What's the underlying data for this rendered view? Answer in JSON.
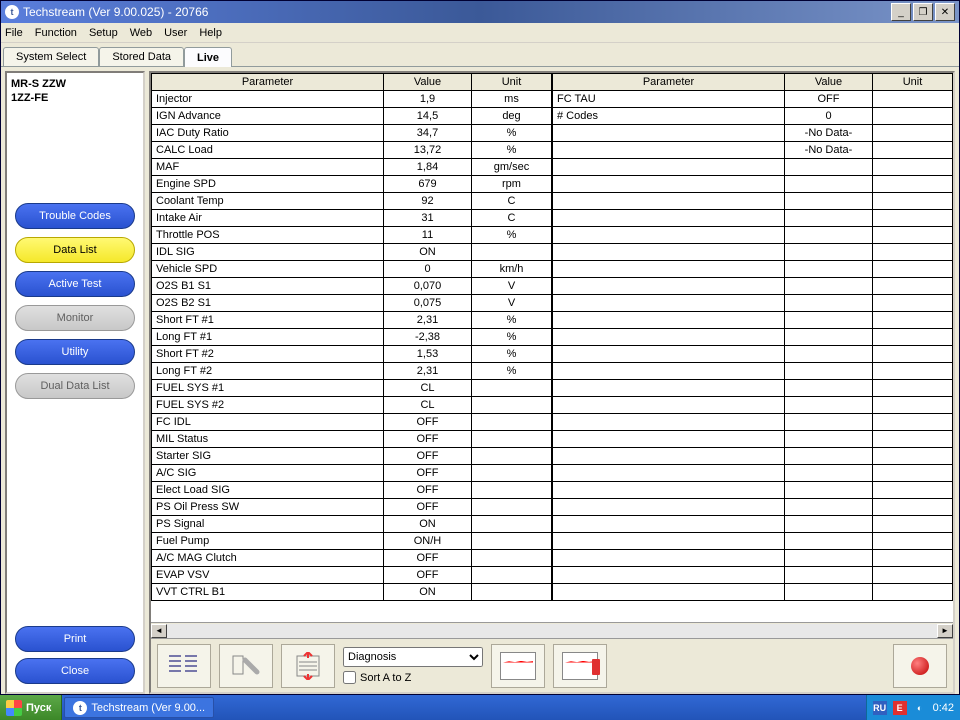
{
  "titlebar": {
    "text": "Techstream (Ver 9.00.025) - 20766"
  },
  "menus": [
    "File",
    "Function",
    "Setup",
    "Web",
    "User",
    "Help"
  ],
  "tabs": [
    {
      "label": "System Select",
      "active": false
    },
    {
      "label": "Stored Data",
      "active": false
    },
    {
      "label": "Live",
      "active": true
    }
  ],
  "vehicle": {
    "line1": "MR-S ZZW",
    "line2": "1ZZ-FE"
  },
  "sidebuttons": [
    {
      "label": "Trouble Codes",
      "style": "blue"
    },
    {
      "label": "Data List",
      "style": "yellow"
    },
    {
      "label": "Active Test",
      "style": "blue"
    },
    {
      "label": "Monitor",
      "style": "grey"
    },
    {
      "label": "Utility",
      "style": "blue"
    },
    {
      "label": "Dual Data List",
      "style": "grey"
    }
  ],
  "bottombuttons": [
    {
      "label": "Print",
      "style": "blue"
    },
    {
      "label": "Close",
      "style": "blue"
    }
  ],
  "headers": {
    "param": "Parameter",
    "value": "Value",
    "unit": "Unit"
  },
  "rows_left": [
    {
      "p": "Injector",
      "v": "1,9",
      "u": "ms"
    },
    {
      "p": "IGN Advance",
      "v": "14,5",
      "u": "deg"
    },
    {
      "p": "IAC Duty Ratio",
      "v": "34,7",
      "u": "%"
    },
    {
      "p": "CALC Load",
      "v": "13,72",
      "u": "%"
    },
    {
      "p": "MAF",
      "v": "1,84",
      "u": "gm/sec"
    },
    {
      "p": "Engine SPD",
      "v": "679",
      "u": "rpm"
    },
    {
      "p": "Coolant Temp",
      "v": "92",
      "u": "C"
    },
    {
      "p": "Intake Air",
      "v": "31",
      "u": "C"
    },
    {
      "p": "Throttle POS",
      "v": "11",
      "u": "%"
    },
    {
      "p": "IDL SIG",
      "v": "ON",
      "u": ""
    },
    {
      "p": "Vehicle SPD",
      "v": "0",
      "u": "km/h"
    },
    {
      "p": "O2S B1 S1",
      "v": "0,070",
      "u": "V"
    },
    {
      "p": "O2S B2 S1",
      "v": "0,075",
      "u": "V"
    },
    {
      "p": "Short FT #1",
      "v": "2,31",
      "u": "%"
    },
    {
      "p": "Long FT #1",
      "v": "-2,38",
      "u": "%"
    },
    {
      "p": "Short FT #2",
      "v": "1,53",
      "u": "%"
    },
    {
      "p": "Long FT #2",
      "v": "2,31",
      "u": "%"
    },
    {
      "p": "FUEL SYS #1",
      "v": "CL",
      "u": ""
    },
    {
      "p": "FUEL SYS #2",
      "v": "CL",
      "u": ""
    },
    {
      "p": "FC IDL",
      "v": "OFF",
      "u": ""
    },
    {
      "p": "MIL Status",
      "v": "OFF",
      "u": ""
    },
    {
      "p": "Starter SIG",
      "v": "OFF",
      "u": ""
    },
    {
      "p": "A/C SIG",
      "v": "OFF",
      "u": ""
    },
    {
      "p": "Elect Load SIG",
      "v": "OFF",
      "u": ""
    },
    {
      "p": "PS Oil Press SW",
      "v": "OFF",
      "u": ""
    },
    {
      "p": "PS Signal",
      "v": "ON",
      "u": ""
    },
    {
      "p": "Fuel Pump",
      "v": "ON/H",
      "u": ""
    },
    {
      "p": "A/C MAG Clutch",
      "v": "OFF",
      "u": ""
    },
    {
      "p": "EVAP VSV",
      "v": "OFF",
      "u": ""
    },
    {
      "p": "VVT CTRL B1",
      "v": "ON",
      "u": ""
    }
  ],
  "rows_right": [
    {
      "p": "FC TAU",
      "v": "OFF",
      "u": ""
    },
    {
      "p": "# Codes",
      "v": "0",
      "u": ""
    },
    {
      "p": "",
      "v": "-No Data-",
      "u": ""
    },
    {
      "p": "",
      "v": "-No Data-",
      "u": ""
    }
  ],
  "right_empty_rows": 26,
  "combo": {
    "selected": "Diagnosis",
    "sort_label": "Sort A to Z"
  },
  "taskbar": {
    "start": "Пуск",
    "app": "Techstream (Ver 9.00...",
    "lang": "RU",
    "clock": "0:42"
  }
}
